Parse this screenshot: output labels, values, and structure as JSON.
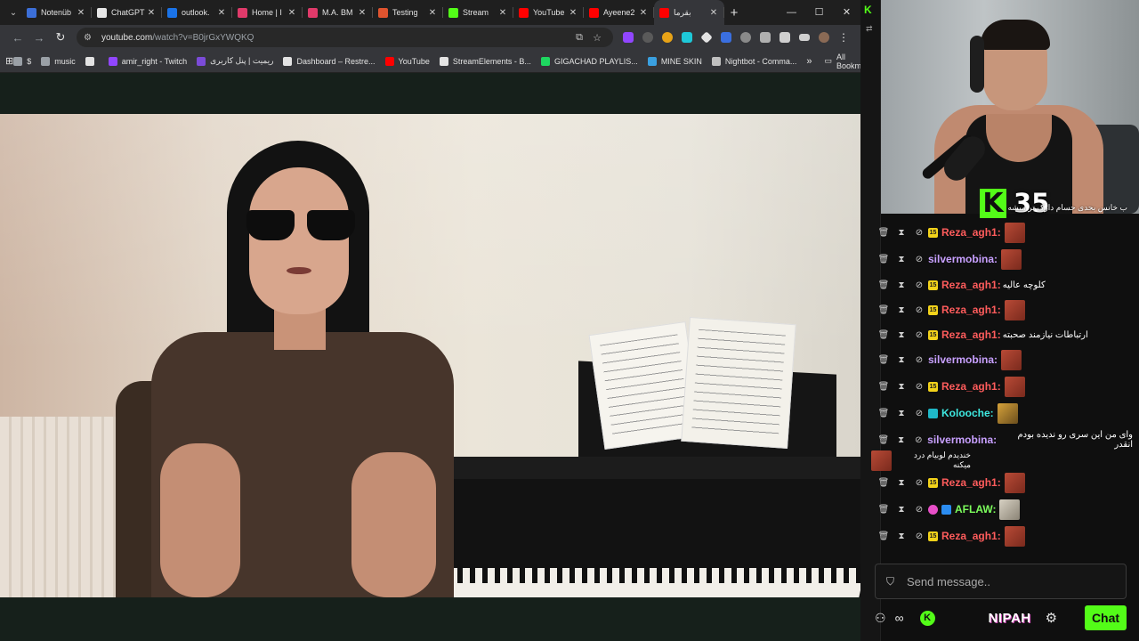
{
  "tabs": [
    {
      "title": "Notenüb",
      "color": "#3c6fd8"
    },
    {
      "title": "ChatGPT",
      "color": "#e6e6e6"
    },
    {
      "title": "outlook.",
      "color": "#1a73e8"
    },
    {
      "title": "Home | I",
      "color": "#e03a6a"
    },
    {
      "title": "M.A. BM",
      "color": "#e03a6a"
    },
    {
      "title": "Testing",
      "color": "#e0542f"
    },
    {
      "title": "Stream",
      "color": "#53fc18"
    },
    {
      "title": "YouTube",
      "color": "#ff0000"
    },
    {
      "title": "Ayeene2",
      "color": "#ff0000"
    },
    {
      "title": "بقرما",
      "color": "#ff0000",
      "active": true
    }
  ],
  "browser": {
    "url_host": "youtube.com",
    "url_path": "/watch?v=B0jrGxYWQKQ"
  },
  "bookmarks": [
    {
      "label": "$",
      "color": "#9aa0a6"
    },
    {
      "label": "music",
      "color": "#9aa0a6"
    },
    {
      "label": "",
      "color": "#e3e3e3"
    },
    {
      "label": "amir_right - Twitch",
      "color": "#9146ff"
    },
    {
      "label": "ریمیت | پنل کاربری",
      "color": "#7b4bd8"
    },
    {
      "label": "Dashboard – Restre...",
      "color": "#e3e3e3"
    },
    {
      "label": "YouTube",
      "color": "#ff0000"
    },
    {
      "label": "StreamElements - B...",
      "color": "#e3e3e3"
    },
    {
      "label": "GIGACHAD PLAYLIS...",
      "color": "#1ed760"
    },
    {
      "label": "MINE SKIN",
      "color": "#3aa0e0"
    },
    {
      "label": "Nightbot - Comma...",
      "color": "#c0c0c0"
    }
  ],
  "bookmarks_all": "All Bookmarks",
  "stream": {
    "badge_count": "35"
  },
  "chat": {
    "top_message": "ب خانس بحدی حسام دارک تر میشه",
    "messages": [
      {
        "user": "Reza_agh1:",
        "color": "#ff5c5c",
        "badge": "sub",
        "text": "",
        "emote": "red"
      },
      {
        "user": "silvermobina:",
        "color": "#c8a0ff",
        "badge": "",
        "text": "",
        "emote": "red"
      },
      {
        "user": "Reza_agh1:",
        "color": "#ff5c5c",
        "badge": "sub",
        "text": "کلوچه عالیه",
        "emote": ""
      },
      {
        "user": "Reza_agh1:",
        "color": "#ff5c5c",
        "badge": "sub",
        "text": "",
        "emote": "red"
      },
      {
        "user": "Reza_agh1:",
        "color": "#ff5c5c",
        "badge": "sub",
        "text": "ارتباطات نیازمند صحبته",
        "emote": ""
      },
      {
        "user": "silvermobina:",
        "color": "#c8a0ff",
        "badge": "",
        "text": "",
        "emote": "red"
      },
      {
        "user": "Reza_agh1:",
        "color": "#ff5c5c",
        "badge": "sub",
        "text": "",
        "emote": "red"
      },
      {
        "user": "Kolooche:",
        "color": "#3ee8e0",
        "badge": "tw",
        "text": "",
        "emote": "gold"
      },
      {
        "user": "silvermobina:",
        "color": "#c8a0ff",
        "badge": "",
        "text": "وای من این سری رو ندیده بودم انقدر",
        "emote": ""
      },
      {
        "user": "Reza_agh1:",
        "color": "#ff5c5c",
        "badge": "sub",
        "text": "",
        "emote": "red"
      },
      {
        "user": "AFLAW:",
        "color": "#7cfc5c",
        "badge": "pk",
        "text": "",
        "emote": "cat"
      },
      {
        "user": "Reza_agh1:",
        "color": "#ff5c5c",
        "badge": "sub",
        "text": "",
        "emote": "red"
      }
    ],
    "wrap_text": "خندیدم لوبیام درد میکنه",
    "input_placeholder": "Send message..",
    "brand": "NIPAH",
    "chat_button": "Chat",
    "sub_badge_text": "15"
  }
}
